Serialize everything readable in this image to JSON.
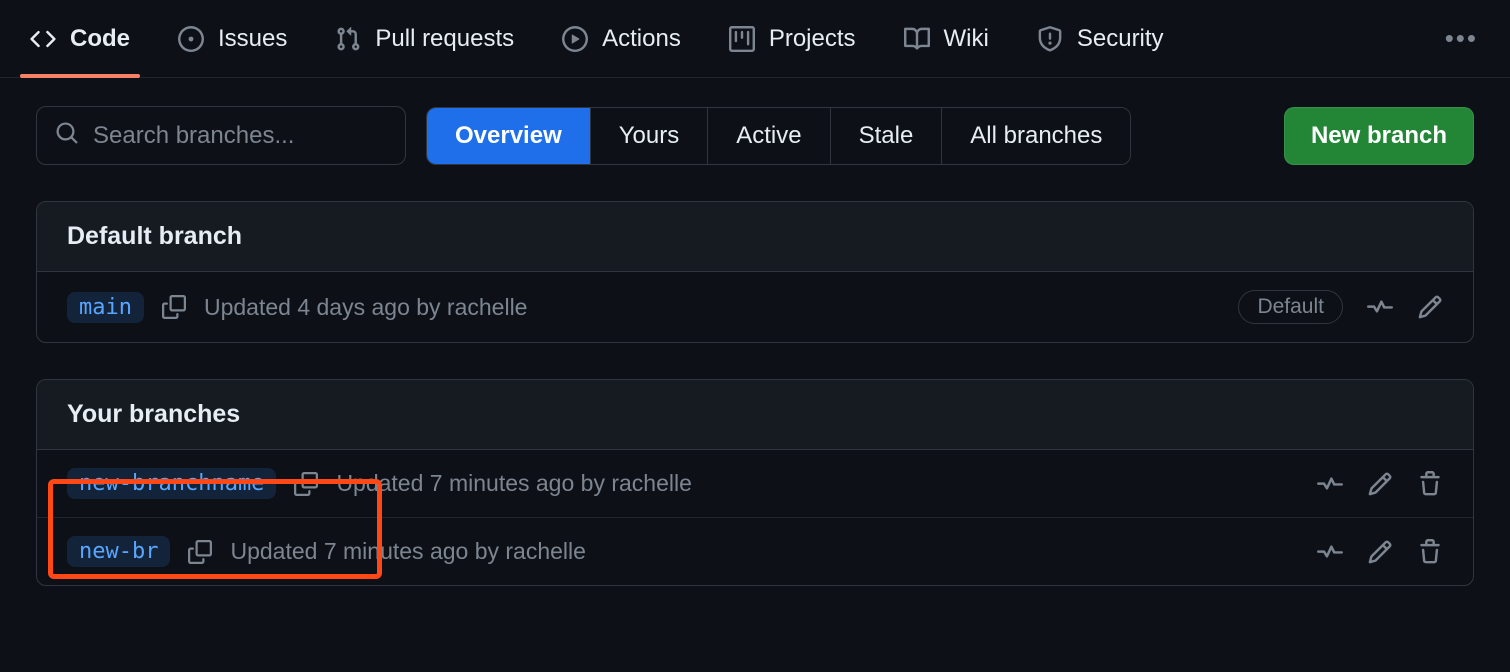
{
  "nav": {
    "tabs": [
      {
        "label": "Code",
        "icon": "code"
      },
      {
        "label": "Issues",
        "icon": "issue"
      },
      {
        "label": "Pull requests",
        "icon": "pr"
      },
      {
        "label": "Actions",
        "icon": "play"
      },
      {
        "label": "Projects",
        "icon": "project"
      },
      {
        "label": "Wiki",
        "icon": "book"
      },
      {
        "label": "Security",
        "icon": "shield"
      }
    ],
    "active_index": 0
  },
  "toolbar": {
    "search_placeholder": "Search branches...",
    "filters": [
      "Overview",
      "Yours",
      "Active",
      "Stale",
      "All branches"
    ],
    "filter_active_index": 0,
    "new_branch_label": "New branch"
  },
  "sections": {
    "default": {
      "title": "Default branch",
      "branch": {
        "name": "main",
        "meta": "Updated 4 days ago by rachelle",
        "badge": "Default"
      }
    },
    "yours": {
      "title": "Your branches",
      "branches": [
        {
          "name": "new-branchname",
          "meta": "Updated 7 minutes ago by rachelle"
        },
        {
          "name": "new-br",
          "meta": "Updated 7 minutes ago by rachelle"
        }
      ]
    }
  }
}
